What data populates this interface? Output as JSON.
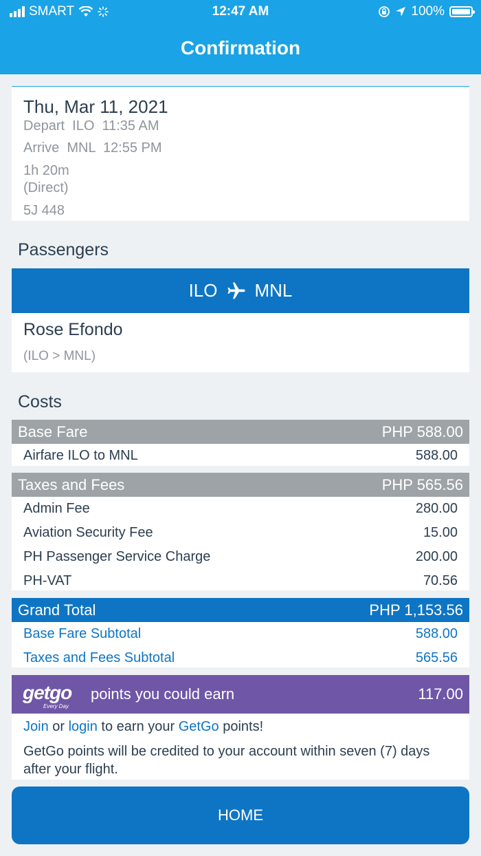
{
  "status_bar": {
    "carrier": "SMART",
    "time": "12:47 AM",
    "battery": "100%"
  },
  "header": {
    "title": "Confirmation"
  },
  "flight": {
    "date": "Thu, Mar 11, 2021",
    "depart": "Depart  ILO  11:35 AM",
    "arrive": "Arrive  MNL  12:55 PM",
    "duration": "1h 20m",
    "type": "(Direct)",
    "flight_no": "5J 448"
  },
  "passengers": {
    "section_title": "Passengers",
    "route_from": "ILO",
    "route_to": "MNL",
    "name": "Rose Efondo",
    "route": "(ILO > MNL)"
  },
  "costs": {
    "section_title": "Costs",
    "base_fare": {
      "label": "Base Fare",
      "amount": "PHP 588.00",
      "items": [
        {
          "label": "Airfare ILO to MNL",
          "value": "588.00"
        }
      ]
    },
    "taxes": {
      "label": "Taxes and Fees",
      "amount": "PHP 565.56",
      "items": [
        {
          "label": "Admin Fee",
          "value": "280.00"
        },
        {
          "label": "Aviation Security Fee",
          "value": "15.00"
        },
        {
          "label": "PH Passenger Service Charge",
          "value": "200.00"
        },
        {
          "label": "PH-VAT",
          "value": "70.56"
        }
      ]
    },
    "grand_total": {
      "label": "Grand Total",
      "amount": "PHP 1,153.56",
      "items": [
        {
          "label": "Base Fare Subtotal",
          "value": "588.00"
        },
        {
          "label": "Taxes and Fees Subtotal",
          "value": "565.56"
        }
      ]
    }
  },
  "getgo": {
    "logo": "getgo",
    "tagline": "Every Day",
    "label": "points you could earn",
    "points": "117.00",
    "join": "Join",
    "or": " or ",
    "login": "login",
    "to_earn": " to earn your ",
    "brand": "GetGo",
    "points_suffix": " points!",
    "note": "GetGo points will be credited to your account within seven (7) days after your flight."
  },
  "home_button": "HOME"
}
